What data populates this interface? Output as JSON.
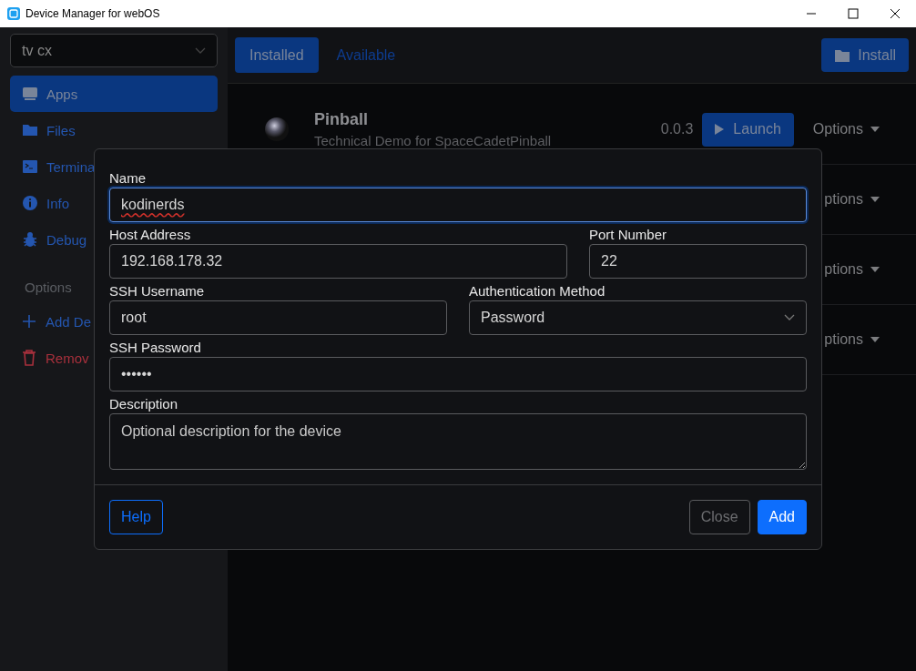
{
  "window": {
    "title": "Device Manager for webOS"
  },
  "device_select": {
    "value": "tv cx"
  },
  "sidebar": {
    "items": [
      {
        "label": "Apps",
        "selected": true
      },
      {
        "label": "Files",
        "selected": false
      },
      {
        "label": "Termina",
        "selected": false
      },
      {
        "label": "Info",
        "selected": false
      },
      {
        "label": "Debug",
        "selected": false
      }
    ],
    "options_heading": "Options",
    "actions": [
      {
        "label": "Add De",
        "kind": "add"
      },
      {
        "label": "Remov",
        "kind": "danger"
      }
    ]
  },
  "tabs": [
    {
      "label": "Installed",
      "selected": true
    },
    {
      "label": "Available",
      "selected": false
    }
  ],
  "install_button": "Install",
  "apps": [
    {
      "name": "Pinball",
      "description": "Technical Demo for SpaceCadetPinball",
      "version": "0.0.3",
      "launch": "Launch",
      "options": "Options"
    },
    {
      "options": "ptions"
    },
    {
      "options": "ptions"
    },
    {
      "options": "ptions"
    }
  ],
  "dialog": {
    "fields": [
      {
        "kind": "text",
        "label": "Name",
        "value": "kodinerds",
        "focused": true
      },
      {
        "kind": "text",
        "label": "Host Address",
        "value": "192.168.178.32",
        "focused": false
      },
      {
        "kind": "text",
        "label": "Port Number",
        "value": "22",
        "focused": false
      },
      {
        "kind": "text",
        "label": "SSH Username",
        "value": "root",
        "focused": false
      },
      {
        "kind": "select",
        "label": "Authentication Method",
        "value": "Password",
        "focused": false
      },
      {
        "kind": "text",
        "label": "SSH Password",
        "value": "••••••",
        "focused": false
      },
      {
        "kind": "textarea",
        "label": "Description",
        "placeholder": "Optional description for the device",
        "focused": false
      }
    ],
    "help_button": "Help",
    "close_button": "Close",
    "add_button": "Add"
  }
}
